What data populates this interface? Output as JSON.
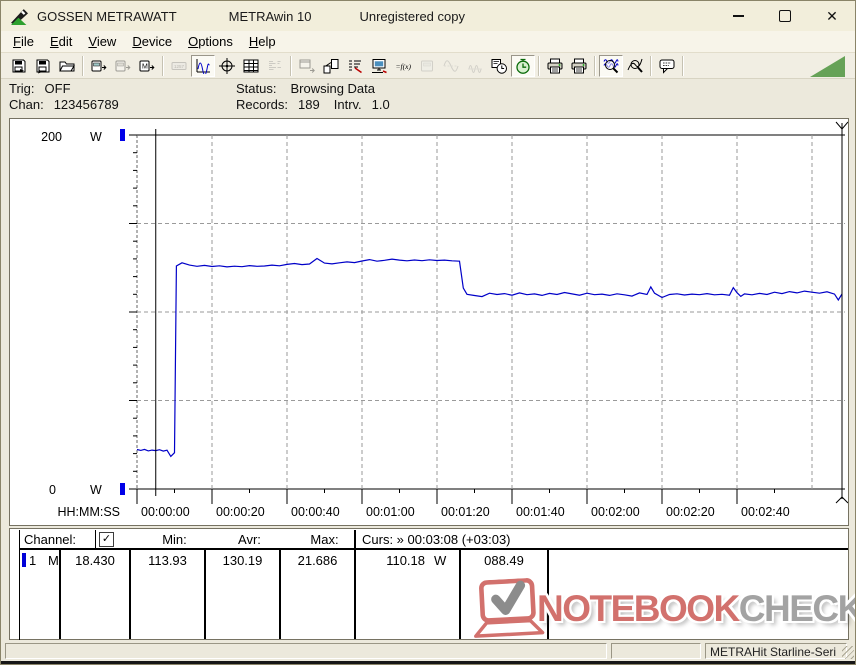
{
  "window": {
    "brand": "GOSSEN METRAWATT",
    "app_name": "METRAwin 10",
    "license": "Unregistered copy"
  },
  "menu": {
    "items": [
      "File",
      "Edit",
      "View",
      "Device",
      "Options",
      "Help"
    ]
  },
  "toolbar": {
    "items": [
      {
        "name": "save",
        "icon": "disk",
        "state": "normal"
      },
      {
        "name": "save-as",
        "icon": "disk2",
        "state": "normal"
      },
      {
        "name": "open-file",
        "icon": "folder",
        "state": "normal"
      },
      {
        "name": "sep"
      },
      {
        "name": "device-read",
        "icon": "devout",
        "state": "normal"
      },
      {
        "name": "device-stop",
        "icon": "devout",
        "state": "disabled"
      },
      {
        "name": "device-memory",
        "icon": "devm",
        "state": "normal"
      },
      {
        "name": "sep"
      },
      {
        "name": "lcd-display",
        "icon": "lcd",
        "state": "disabled"
      },
      {
        "name": "waveform-view",
        "icon": "wave",
        "state": "active"
      },
      {
        "name": "cursor-view",
        "icon": "crosshair",
        "state": "normal"
      },
      {
        "name": "table-view",
        "icon": "table",
        "state": "normal"
      },
      {
        "name": "statistics-view",
        "icon": "hist",
        "state": "disabled"
      },
      {
        "name": "sep"
      },
      {
        "name": "export-window",
        "icon": "winout",
        "state": "disabled"
      },
      {
        "name": "device-transfer",
        "icon": "devtrans",
        "state": "normal"
      },
      {
        "name": "channel-list",
        "icon": "list",
        "state": "normal"
      },
      {
        "name": "device-monitor",
        "icon": "monitor",
        "state": "normal"
      },
      {
        "name": "formula",
        "icon": "fx",
        "state": "normal"
      },
      {
        "name": "device-config",
        "icon": "dev",
        "state": "disabled"
      },
      {
        "name": "analog-signal",
        "icon": "sine",
        "state": "disabled"
      },
      {
        "name": "pulse-signal",
        "icon": "coil",
        "state": "disabled"
      },
      {
        "name": "schedule",
        "icon": "clockdev",
        "state": "normal"
      },
      {
        "name": "timer",
        "icon": "timer",
        "state": "active"
      },
      {
        "name": "sep"
      },
      {
        "name": "print",
        "icon": "printer",
        "state": "normal"
      },
      {
        "name": "print-preview",
        "icon": "printer",
        "state": "normal"
      },
      {
        "name": "sep"
      },
      {
        "name": "zoom-time",
        "icon": "zoomwave",
        "state": "active"
      },
      {
        "name": "zoom-free",
        "icon": "zoomcurve",
        "state": "normal"
      },
      {
        "name": "sep"
      },
      {
        "name": "tooltip",
        "icon": "bubble",
        "state": "normal"
      },
      {
        "name": "sep"
      }
    ]
  },
  "status_panel": {
    "trig_label": "Trig:",
    "trig_value": "OFF",
    "chan_label": "Chan:",
    "chan_value": "123456789",
    "status_label": "Status:",
    "status_value": "Browsing Data",
    "records_label": "Records:",
    "records_value": "189",
    "interval_label": "Intrv.",
    "interval_value": "1.0"
  },
  "chart_data": {
    "type": "line",
    "x_axis_label": "HH:MM:SS",
    "x_tick_labels": [
      "00:00:00",
      "00:00:20",
      "00:00:40",
      "00:01:00",
      "00:01:20",
      "00:01:40",
      "00:02:00",
      "00:02:20",
      "00:02:40"
    ],
    "x_tick_interval_s": 20,
    "x_range_s": [
      0,
      189
    ],
    "y_axis": {
      "min": 0,
      "max": 200,
      "unit": "W",
      "max_label": "200",
      "min_label": "0",
      "gridline_step": 50,
      "minor_tick_step": 10
    },
    "grid": true,
    "series": [
      {
        "name": "channel-1-power",
        "color": "#0000c8",
        "points": [
          [
            0,
            22.3
          ],
          [
            1,
            21.8
          ],
          [
            2,
            22.4
          ],
          [
            3,
            21.5
          ],
          [
            4,
            22.0
          ],
          [
            5,
            21.686
          ],
          [
            6,
            22.2
          ],
          [
            7,
            21.4
          ],
          [
            8,
            21.9
          ],
          [
            9,
            18.43
          ],
          [
            10,
            20.5
          ],
          [
            10.5,
            126
          ],
          [
            12,
            127.8
          ],
          [
            14,
            126.5
          ],
          [
            16,
            125.8
          ],
          [
            18,
            126.3
          ],
          [
            20,
            125.7
          ],
          [
            22,
            126.1
          ],
          [
            24,
            125.5
          ],
          [
            26,
            125.9
          ],
          [
            28,
            125.6
          ],
          [
            30,
            126.2
          ],
          [
            32,
            125.8
          ],
          [
            34,
            126.0
          ],
          [
            36,
            126.5
          ],
          [
            38,
            126.1
          ],
          [
            40,
            126.9
          ],
          [
            42,
            127.4
          ],
          [
            44,
            126.8
          ],
          [
            46,
            127.1
          ],
          [
            48,
            130.2
          ],
          [
            50,
            127.6
          ],
          [
            52,
            127.2
          ],
          [
            54,
            127.8
          ],
          [
            56,
            128.3
          ],
          [
            58,
            127.9
          ],
          [
            60,
            128.8
          ],
          [
            62,
            129.6
          ],
          [
            64,
            128.7
          ],
          [
            66,
            129.2
          ],
          [
            68,
            129.9
          ],
          [
            70,
            129.3
          ],
          [
            72,
            128.9
          ],
          [
            74,
            129.4
          ],
          [
            76,
            129.0
          ],
          [
            78,
            129.5
          ],
          [
            80,
            129.1
          ],
          [
            82,
            129.3
          ],
          [
            84,
            128.9
          ],
          [
            86,
            128.7
          ],
          [
            87,
            113.5
          ],
          [
            88,
            110.0
          ],
          [
            90,
            109.3
          ],
          [
            92,
            108.7
          ],
          [
            94,
            110.6
          ],
          [
            96,
            109.9
          ],
          [
            98,
            110.4
          ],
          [
            100,
            109.5
          ],
          [
            102,
            110.8
          ],
          [
            104,
            109.8
          ],
          [
            106,
            110.2
          ],
          [
            108,
            109.4
          ],
          [
            110,
            110.5
          ],
          [
            112,
            109.9
          ],
          [
            114,
            111.0
          ],
          [
            116,
            110.2
          ],
          [
            118,
            109.5
          ],
          [
            120,
            110.6
          ],
          [
            122,
            109.8
          ],
          [
            124,
            110.1
          ],
          [
            126,
            109.4
          ],
          [
            128,
            110.3
          ],
          [
            130,
            109.7
          ],
          [
            132,
            109.0
          ],
          [
            134,
            110.8
          ],
          [
            136,
            109.9
          ],
          [
            137,
            114.2
          ],
          [
            138,
            110.6
          ],
          [
            140,
            108.2
          ],
          [
            142,
            109.9
          ],
          [
            144,
            110.3
          ],
          [
            146,
            109.6
          ],
          [
            148,
            110.1
          ],
          [
            150,
            109.8
          ],
          [
            152,
            110.4
          ],
          [
            154,
            109.7
          ],
          [
            156,
            110.0
          ],
          [
            158,
            109.5
          ],
          [
            159,
            113.8
          ],
          [
            160,
            110.9
          ],
          [
            161,
            108.8
          ],
          [
            162,
            110.2
          ],
          [
            164,
            109.7
          ],
          [
            166,
            110.5
          ],
          [
            168,
            109.9
          ],
          [
            170,
            111.2
          ],
          [
            172,
            110.4
          ],
          [
            174,
            111.5
          ],
          [
            176,
            110.8
          ],
          [
            178,
            111.8
          ],
          [
            180,
            111.2
          ],
          [
            182,
            110.6
          ],
          [
            184,
            111.4
          ],
          [
            186,
            110.1
          ],
          [
            187,
            106.8
          ],
          [
            188,
            110.18
          ]
        ]
      }
    ],
    "cursors": {
      "cursor1_t_s": 5,
      "cursor2_t_s": 188,
      "cursor2_time": "00:03:08",
      "delta_time": "+03:03"
    },
    "stats": {
      "min": 18.43,
      "avr": 113.93,
      "max": 130.19,
      "cursor1_value": 21.686,
      "cursor2_value": 110.18,
      "delta": 88.49,
      "unit": "W"
    }
  },
  "table": {
    "header": {
      "channel": "Channel:",
      "checkbox": "✓",
      "min": "Min:",
      "avr": "Avr:",
      "max": "Max:",
      "curs": "Curs: » 00:03:08 (+03:03)"
    },
    "row": {
      "channel": "1",
      "mode": "M",
      "min": "18.430",
      "avr": "113.93",
      "max": "130.19",
      "curs1": "21.686",
      "curs2": "110.18",
      "curs2_unit": "W",
      "delta": "088.49"
    }
  },
  "statusbar": {
    "device": "METRAHit Starline-Seri"
  },
  "watermark": {
    "text_red": "NOTEBOOK",
    "text_gray": "CHECK"
  },
  "colors": {
    "trace": "#0000c8",
    "axis_marker_blue": "#0000e8",
    "connection_green": "#66a257",
    "logo_red": "#d2716d",
    "logo_gray": "#a3a3a3"
  }
}
